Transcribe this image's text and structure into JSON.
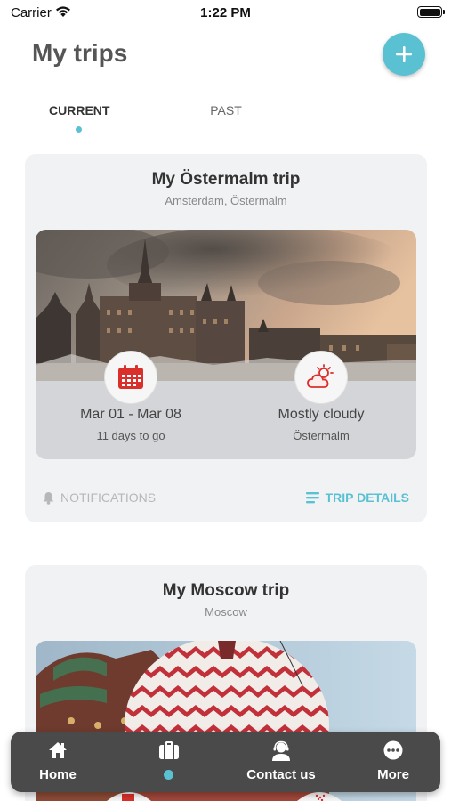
{
  "status_bar": {
    "carrier": "Carrier",
    "time": "1:22 PM"
  },
  "header": {
    "title": "My trips",
    "add_icon": "plus-icon"
  },
  "tabs": [
    {
      "label": "CURRENT",
      "active": true
    },
    {
      "label": "PAST",
      "active": false
    }
  ],
  "trips": [
    {
      "title": "My Östermalm trip",
      "location": "Amsterdam, Östermalm",
      "dates": "Mar 01 - Mar 08",
      "countdown": "11 days to go",
      "weather": "Mostly cloudy",
      "weather_location": "Östermalm",
      "notifications_label": "NOTIFICATIONS",
      "details_label": "TRIP DETAILS"
    },
    {
      "title": "My Moscow trip",
      "location": "Moscow"
    }
  ],
  "tabbar": {
    "items": [
      {
        "label": "Home",
        "icon": "home-icon"
      },
      {
        "label": "",
        "icon": "briefcase-icon",
        "active": true
      },
      {
        "label": "Contact us",
        "icon": "support-agent-icon"
      },
      {
        "label": "More",
        "icon": "more-dots-icon"
      }
    ]
  },
  "colors": {
    "accent": "#5ac1d3",
    "icon_red": "#d9302c",
    "tabbar_bg": "#4a4a4a"
  }
}
